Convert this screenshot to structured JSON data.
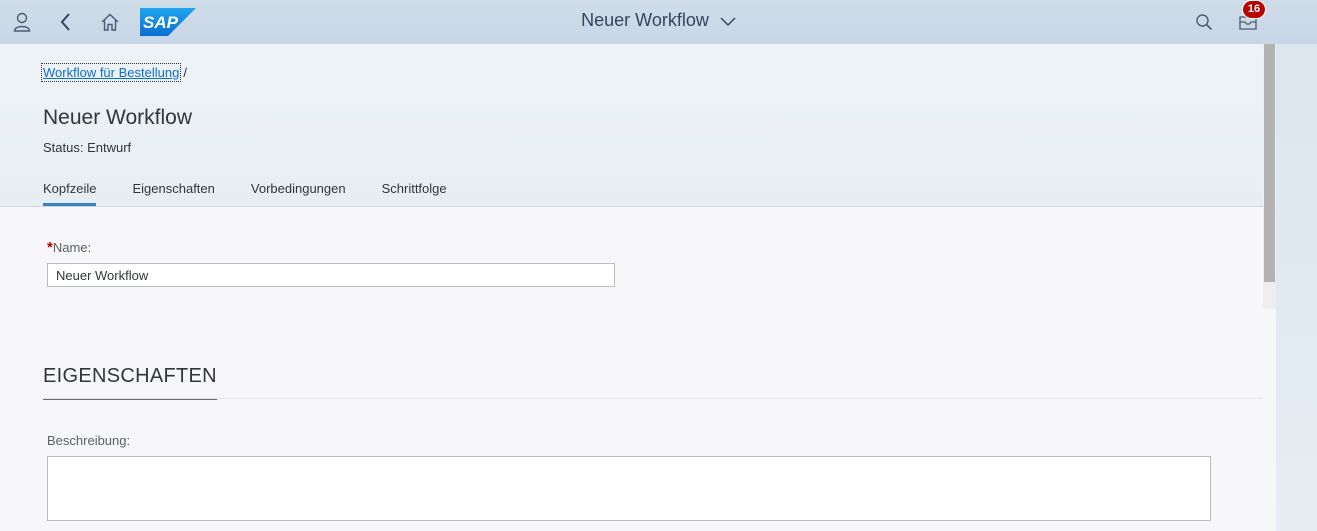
{
  "shell": {
    "title": "Neuer Workflow",
    "notification_count": "16",
    "logo_text": "SAP"
  },
  "breadcrumb": {
    "link": "Workflow für Bestellung",
    "separator": "/"
  },
  "page": {
    "title": "Neuer Workflow",
    "status": "Status: Entwurf"
  },
  "tabs": [
    {
      "label": "Kopfzeile",
      "active": true
    },
    {
      "label": "Eigenschaften",
      "active": false
    },
    {
      "label": "Vorbedingungen",
      "active": false
    },
    {
      "label": "Schrittfolge",
      "active": false
    }
  ],
  "form": {
    "name_required_marker": "*",
    "name_label": "Name:",
    "name_value": "Neuer Workflow"
  },
  "section": {
    "title": "EIGENSCHAFTEN",
    "description_label": "Beschreibung:",
    "description_value": ""
  },
  "colors": {
    "accent": "#0a6ed1",
    "required": "#bb0000",
    "badge": "#bb0000"
  }
}
